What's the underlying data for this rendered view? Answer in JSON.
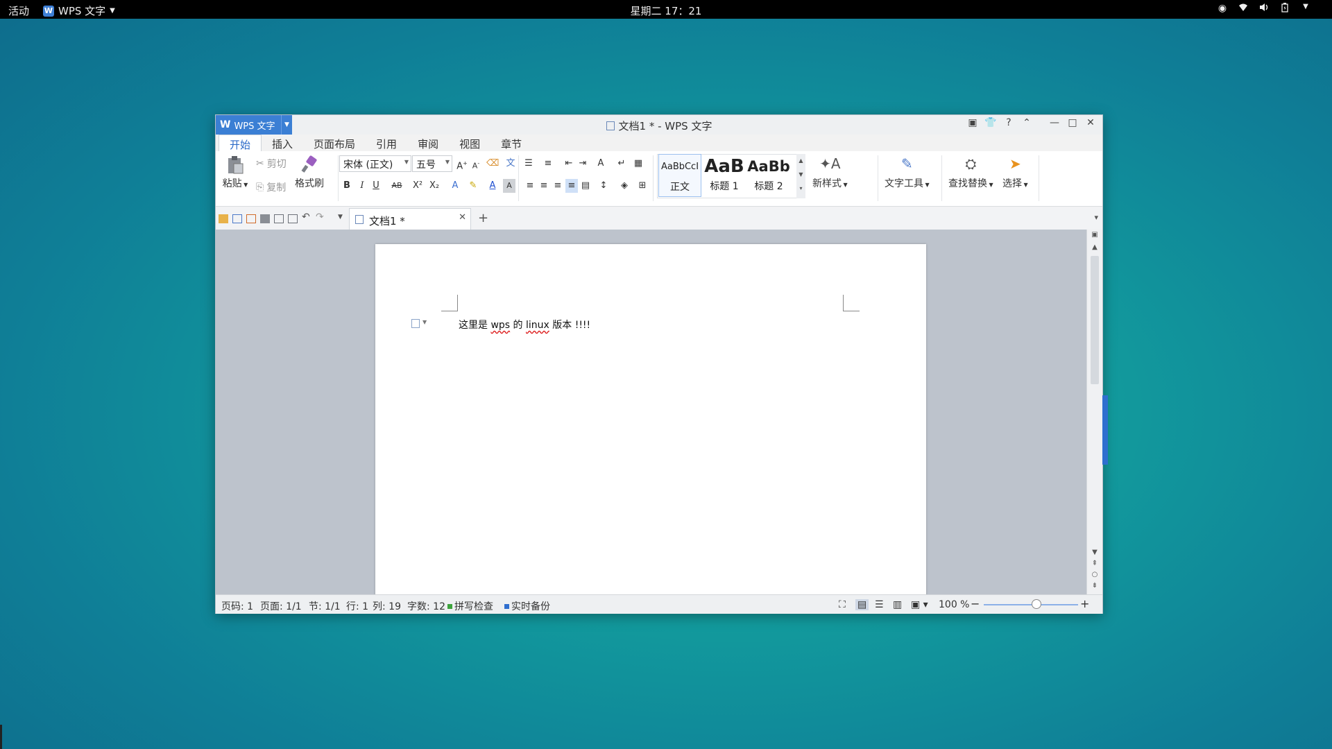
{
  "topbar": {
    "activities": "活动",
    "app_name": "WPS 文字",
    "clock": "星期二 17：21",
    "tray_icons": [
      "record-icon",
      "wifi-icon",
      "volume-icon",
      "battery-icon",
      "power-menu-icon"
    ]
  },
  "window": {
    "app_button": "WPS 文字",
    "title": "文档1 * - WPS 文字",
    "help_label": "?"
  },
  "tabs": [
    "开始",
    "插入",
    "页面布局",
    "引用",
    "审阅",
    "视图",
    "章节"
  ],
  "ribbon": {
    "paste": "粘贴",
    "cut": "剪切",
    "copy": "复制",
    "format_painter": "格式刷",
    "font_name": "宋体 (正文)",
    "font_size": "五号",
    "bold": "B",
    "italic": "I",
    "underline": "U",
    "strike": "AB",
    "superscript": "X²",
    "subscript": "X₂",
    "styles": [
      {
        "sample": "AaBbCcI",
        "label": "正文"
      },
      {
        "sample": "AaB",
        "label": "标题 1"
      },
      {
        "sample": "AaBb",
        "label": "标题 2"
      }
    ],
    "new_style": "新样式",
    "text_tools": "文字工具",
    "find_replace": "查找替换",
    "select": "选择"
  },
  "doc_tab": {
    "label": "文档1 *"
  },
  "document": {
    "text_before": "这里是 ",
    "word1": "wps",
    "text_mid": " 的 ",
    "word2": "linux",
    "text_after": " 版本 !!!!"
  },
  "statusbar": {
    "page_no": "页码: 1",
    "page": "页面: 1/1",
    "section": "节: 1/1",
    "line": "行: 1",
    "col": "列: 19",
    "words": "字数: 12",
    "spellcheck": "拼写检查",
    "backup": "实时备份",
    "zoom": "100 %",
    "zoom_minus": "−",
    "zoom_plus": "+",
    "zoom_level": 100
  },
  "colors": {
    "accent": "#3b7fd4",
    "desktop": "#129b9d",
    "spellcheck_dot": "#3ca33c",
    "backup_dot": "#2f6fcf"
  }
}
